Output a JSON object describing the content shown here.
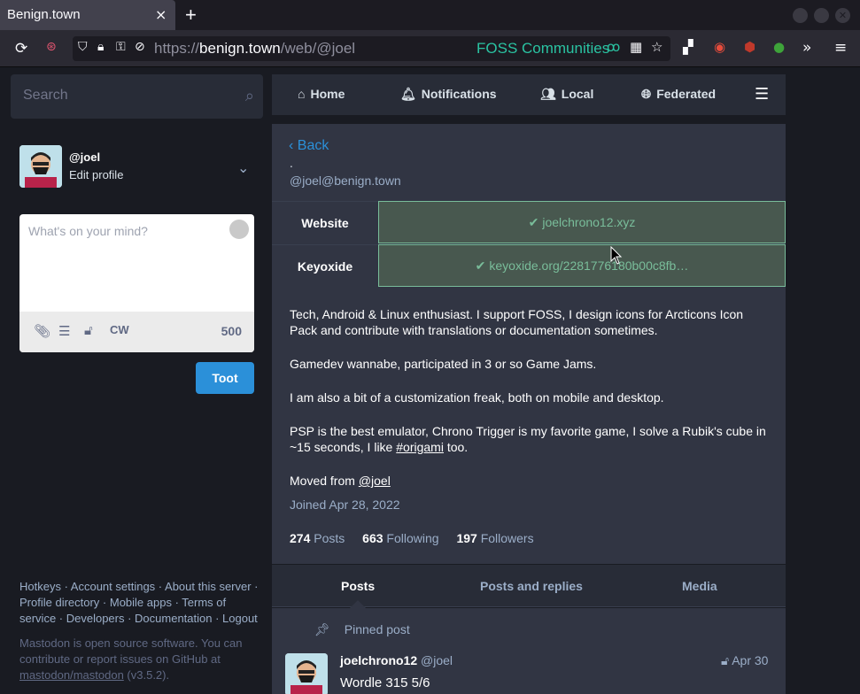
{
  "browser": {
    "tab_title": "Benign.town",
    "tab_close": "×",
    "new_tab": "+",
    "url_prefix": "https://",
    "url_host": "benign.town",
    "url_path": "/web/@joel",
    "container_label": "FOSS Communities",
    "icons": [
      "reload-icon",
      "shield-icon",
      "lock-icon",
      "permissions-icon",
      "bookmark-star-icon",
      "extensions-icon",
      "menu-icon"
    ]
  },
  "search": {
    "placeholder": "Search"
  },
  "me": {
    "handle": "@joel",
    "edit_profile": "Edit profile"
  },
  "compose": {
    "placeholder": "What's on your mind?",
    "cw_label": "CW",
    "char_count": "500",
    "submit_label": "Toot"
  },
  "footer": {
    "links": "Hotkeys · Account settings · About this server · Profile directory · Mobile apps · Terms of service · Developers · Documentation · Logout",
    "about_1": "Mastodon is open source software. You can contribute or report issues on GitHub at",
    "repo": "mastodon/mastodon",
    "version": "(v3.5.2)."
  },
  "nav": {
    "home": "Home",
    "notifications": "Notifications",
    "local": "Local",
    "federated": "Federated"
  },
  "profile": {
    "back": "Back",
    "dot": ".",
    "acct": "@joel@benign.town",
    "fields": [
      {
        "name": "Website",
        "value": "joelchrono12.xyz"
      },
      {
        "name": "Keyoxide",
        "value": "keyoxide.org/2281776180b00c8fb…"
      }
    ],
    "bio_1": "Tech, Android & Linux enthusiast. I support FOSS, I design icons for Arcticons Icon Pack and contribute with translations or documentation sometimes.",
    "bio_2": "Gamedev wannabe, participated in 3 or so Game Jams.",
    "bio_3": "I am also a bit of a customization freak, both on mobile and desktop.",
    "bio_4_pre": "PSP is the best emulator, Chrono Trigger is my favorite game, I solve a Rubik's cube in ~15 seconds, I like",
    "bio_4_tag": "#origami",
    "bio_4_post": "too.",
    "moved_pre": "Moved from",
    "moved_link": "@joel",
    "joined": "Joined Apr 28, 2022",
    "posts_count": "274",
    "posts_label": "Posts",
    "following_count": "663",
    "following_label": "Following",
    "followers_count": "197",
    "followers_label": "Followers"
  },
  "account_tabs": {
    "posts": "Posts",
    "posts_replies": "Posts and replies",
    "media": "Media"
  },
  "feed": {
    "pinned": "Pinned post",
    "author": "joelchrono12",
    "author_handle": "@joel",
    "date": "Apr 30",
    "text": "Wordle 315 5/6"
  }
}
